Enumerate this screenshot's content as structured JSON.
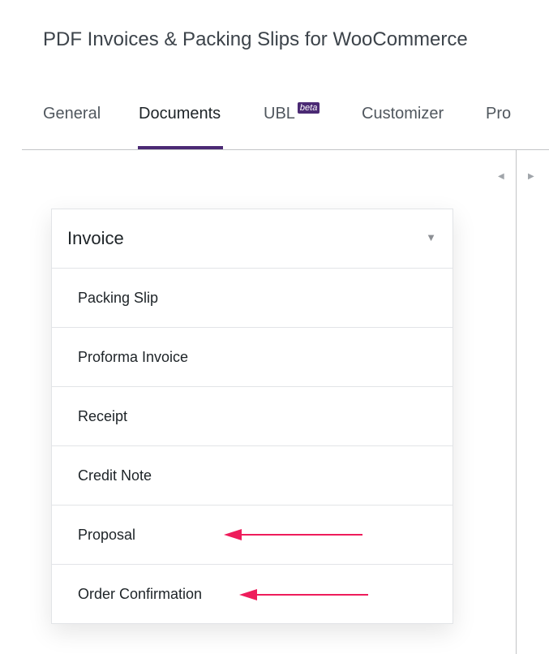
{
  "page": {
    "title": "PDF Invoices & Packing Slips for WooCommerce"
  },
  "tabs": [
    {
      "label": "General",
      "active": false
    },
    {
      "label": "Documents",
      "active": true
    },
    {
      "label": "UBL",
      "badge": "beta",
      "active": false
    },
    {
      "label": "Customizer",
      "active": false
    },
    {
      "label": "Pro",
      "active": false
    }
  ],
  "scroll": {
    "left_icon": "triangle-left",
    "right_icon": "triangle-right"
  },
  "document_select": {
    "selected": "Invoice",
    "caret_icon": "triangle-down",
    "options": [
      "Packing Slip",
      "Proforma Invoice",
      "Receipt",
      "Credit Note",
      "Proposal",
      "Order Confirmation"
    ]
  },
  "annotations": {
    "arrow_color": "#ee1c5b"
  },
  "colors": {
    "accent": "#4b2a74",
    "border": "#e2e4e7",
    "text": "#1d2327"
  }
}
